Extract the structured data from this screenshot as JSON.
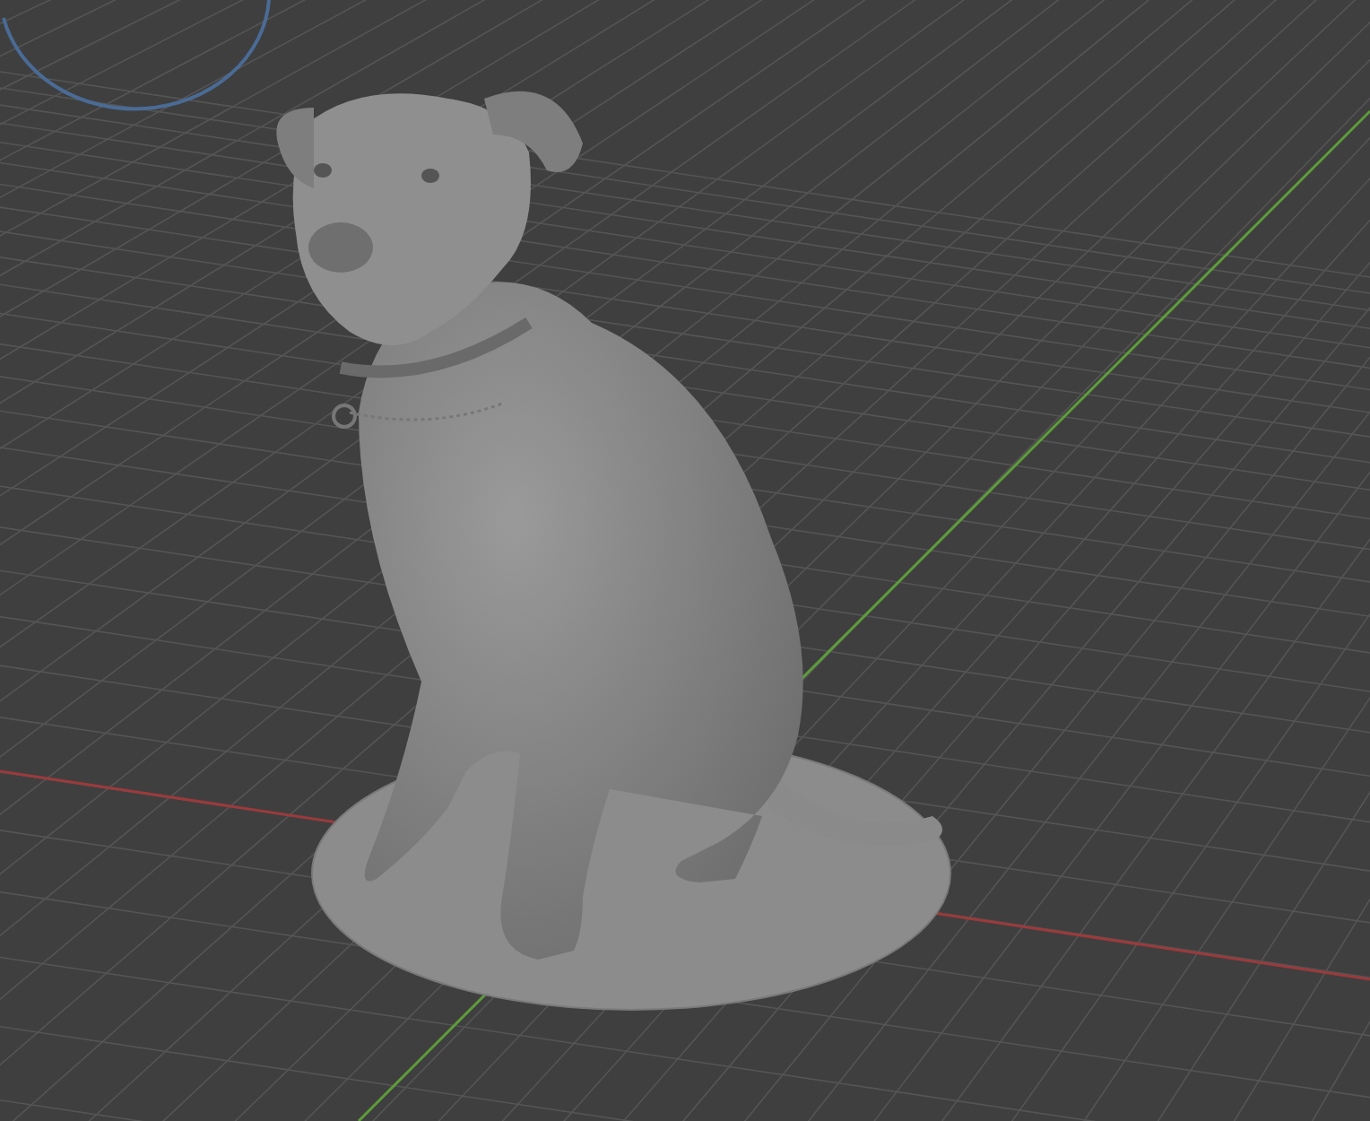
{
  "viewport": {
    "grid": true,
    "axes": [
      {
        "kind": "x",
        "color": "#9b3a3c"
      },
      {
        "kind": "y",
        "color": "#5d9c3a"
      }
    ]
  }
}
